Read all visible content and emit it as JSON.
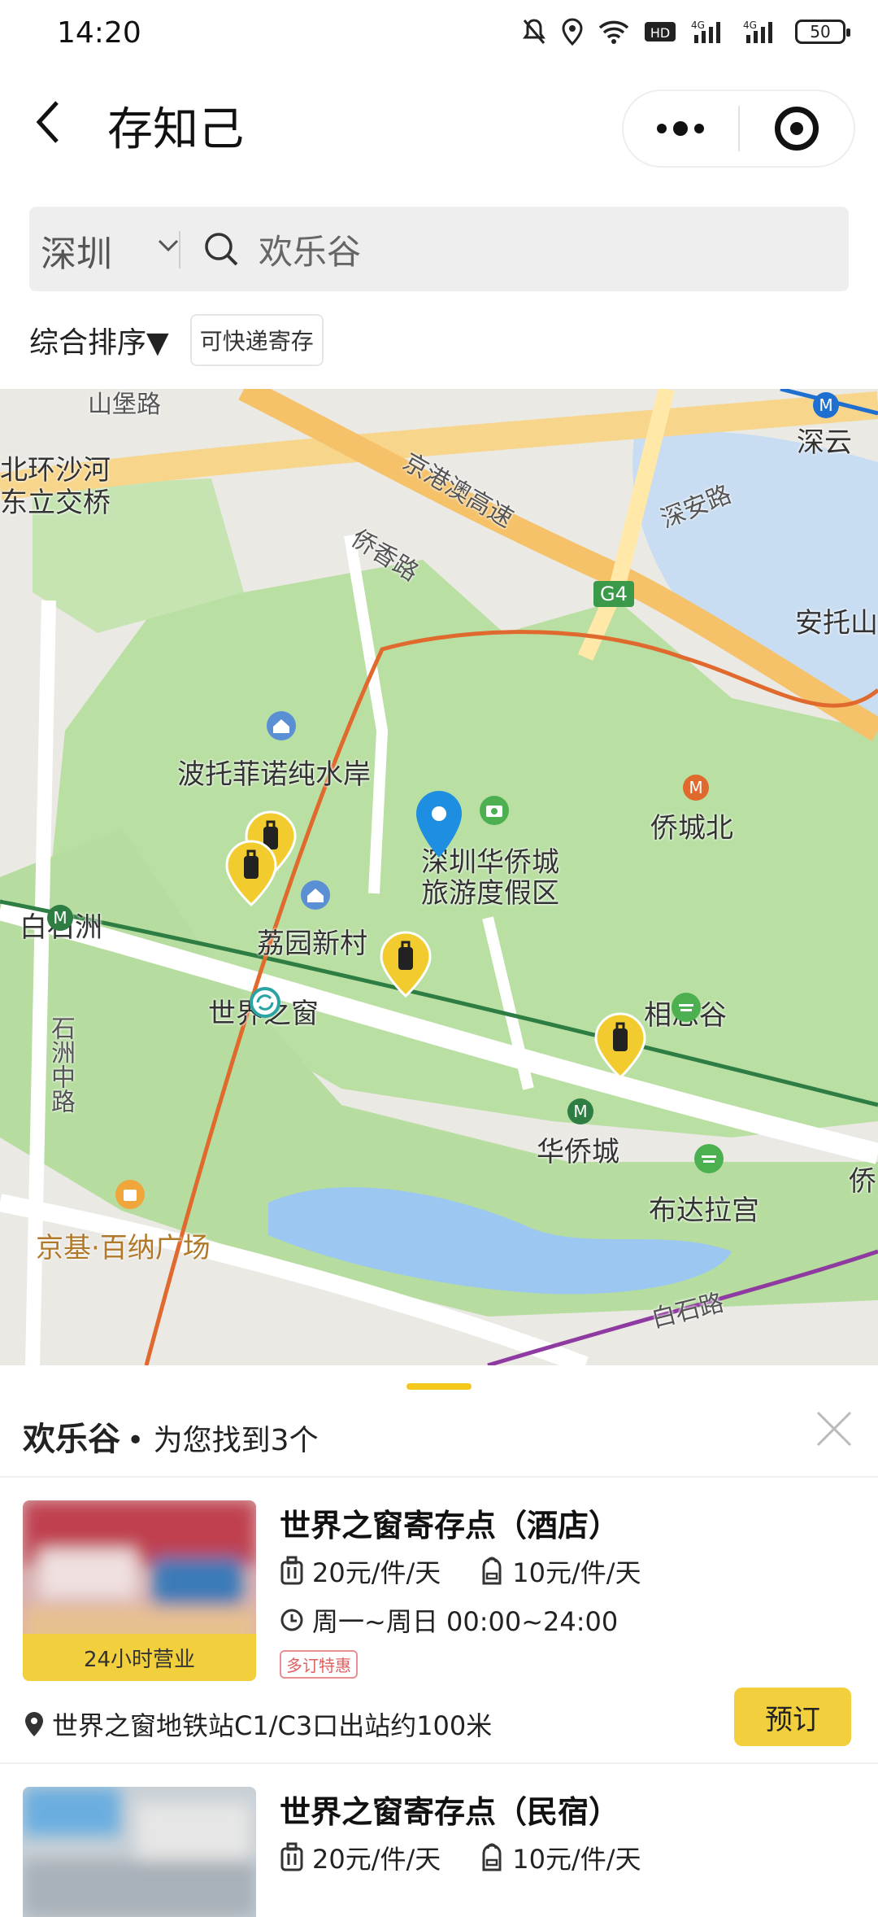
{
  "status_bar": {
    "time": "14:20",
    "battery": "50"
  },
  "nav": {
    "title": "存知己"
  },
  "search": {
    "city": "深圳",
    "keyword": "欢乐谷"
  },
  "filters": {
    "sort_label": "综合排序▼",
    "chip_label": "可快递寄存"
  },
  "map": {
    "labels": {
      "shanbao_rd": "山堡路",
      "shenyun": "深云",
      "beihuan_1": "北环沙河",
      "beihuan_2": "东立交桥",
      "jinggang": "京港澳高速",
      "shenan": "深安路",
      "qiaoxiang": "侨香路",
      "g4": "G4",
      "antuo": "安托山",
      "portofino": "波托菲诺纯水岸",
      "octcity_1": "深圳华侨城",
      "octcity_2": "旅游度假区",
      "qiaochengbei": "侨城北",
      "baishizhou": "白石洲",
      "liyuan": "荔园新村",
      "shizhou_rd": "石洲中路",
      "window": "世界之窗",
      "xiangsigu": "相思谷",
      "huaqiaocheng": "华侨城",
      "potala": "布达拉宫",
      "jingji": "京基·百纳广场",
      "baishi_rd": "白石路",
      "qiao_edge": "侨"
    }
  },
  "panel": {
    "keyword": "欢乐谷",
    "found_text": "• 为您找到3个",
    "stores": [
      {
        "name": "世界之窗寄存点（酒店）",
        "price_large": "20元/件/天",
        "price_small": "10元/件/天",
        "hours": "周一~周日 00:00~24:00",
        "promo": "多订特惠",
        "badge": "24小时营业",
        "address": "世界之窗地铁站C1/C3口出站约100米",
        "book_label": "预订"
      },
      {
        "name": "世界之窗寄存点（民宿）",
        "price_large": "20元/件/天",
        "price_small": "10元/件/天"
      }
    ]
  }
}
